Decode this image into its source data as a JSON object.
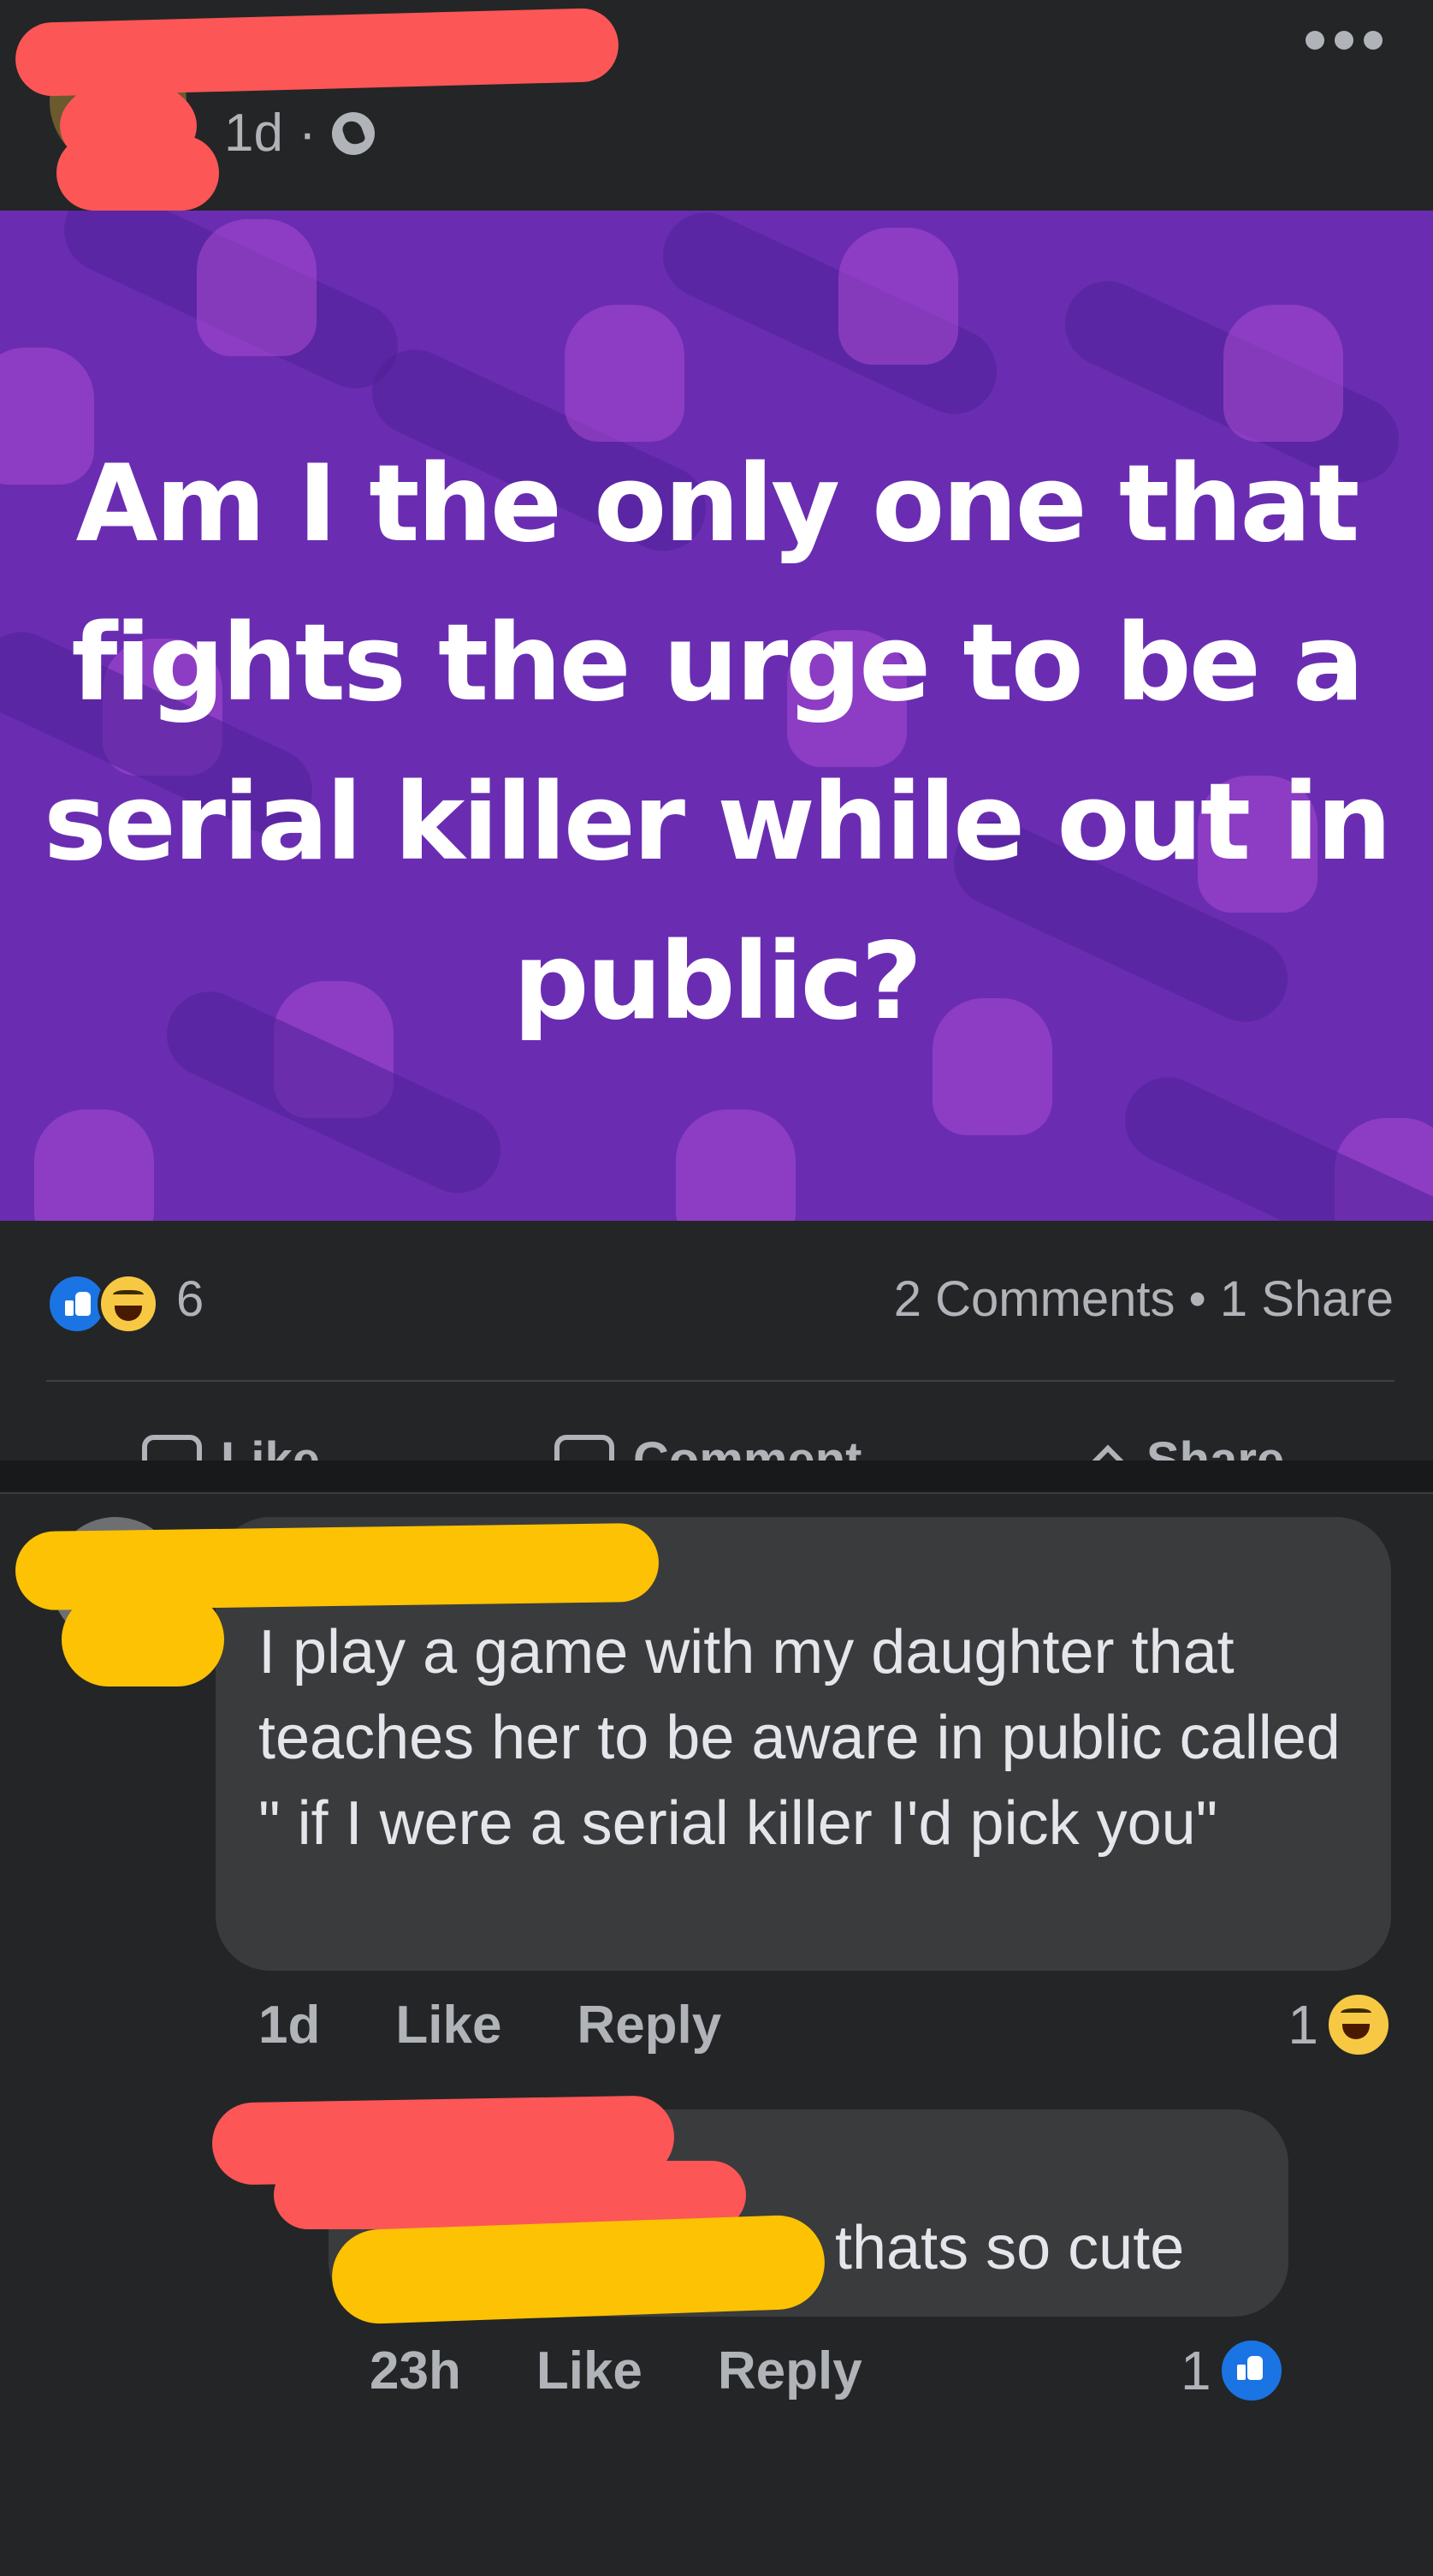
{
  "post": {
    "author_name": "",
    "timestamp": "1d",
    "separator": "·",
    "privacy_icon": "globe-icon",
    "more_icon": "more-horizontal-icon",
    "image_text": "Am I the only one that fights the urge to be a serial killer while out in public?",
    "image_background_color": "#6a2db2"
  },
  "stats": {
    "reaction_icons": [
      "like-reaction-icon",
      "haha-reaction-icon"
    ],
    "reaction_count": "6",
    "comments": "2 Comments",
    "dot": "•",
    "shares": "1 Share"
  },
  "actions": {
    "like": "Like",
    "comment": "Comment",
    "share": "Share"
  },
  "comments": [
    {
      "author_name": "",
      "text": "I play a game with my daughter that teaches her to be aware in public called \" if I were a serial killer I'd pick you\"",
      "time": "1d",
      "like": "Like",
      "reply": "Reply",
      "reaction_count": "1",
      "reaction_icon": "haha-reaction-icon"
    },
    {
      "author_name": "",
      "text": "thats so cute",
      "time": "23h",
      "like": "Like",
      "reply": "Reply",
      "reaction_count": "1",
      "reaction_icon": "like-reaction-icon"
    }
  ],
  "colors": {
    "background": "#18191a",
    "card": "#242526",
    "bubble": "#3a3b3c",
    "accent": "#1b74e4",
    "redaction_red": "#fc5656",
    "redaction_yellow": "#fcc203"
  }
}
